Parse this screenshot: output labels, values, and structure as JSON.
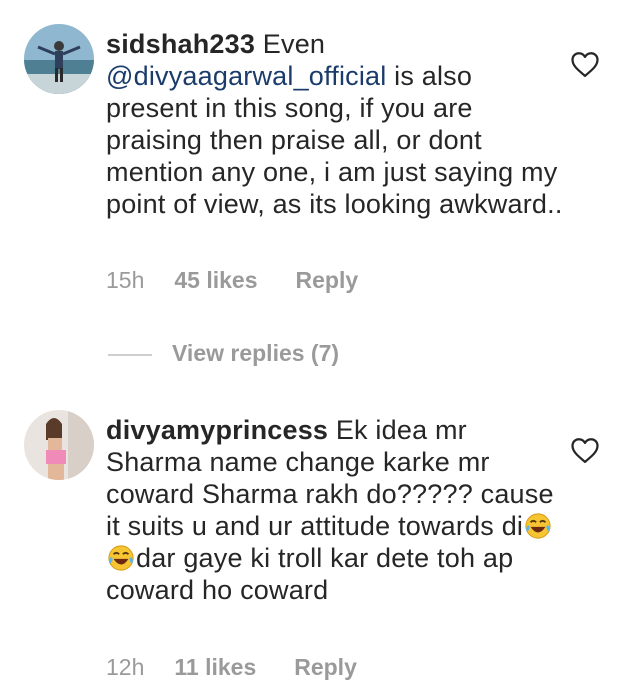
{
  "comments": [
    {
      "username": "sidshah233",
      "text_before": " Even ",
      "mention": "@divyaagarwal_official",
      "text_after": " is also present in this song, if you are praising then praise all, or dont mention any one, i am just saying my point of view, as its looking awkward..",
      "time": "15h",
      "likes": "45 likes",
      "reply": "Reply",
      "view_replies": "View replies (7)",
      "avatar_icon": "avatar-photo-person-beach"
    },
    {
      "username": "divyamyprincess",
      "text_part1": " Ek idea mr Sharma name change karke mr coward Sharma rakh do????? cause it suits u and ur attitude towards di",
      "emoji_1": "😂",
      "emoji_2": "😂",
      "text_part2": "dar gaye ki troll kar dete toh ap coward ho coward",
      "time": "12h",
      "likes": "11 likes",
      "reply": "Reply",
      "avatar_icon": "avatar-photo-person-pink"
    }
  ],
  "colors": {
    "text": "#262626",
    "mention": "#1b3c6b",
    "meta": "#9a9a9a"
  }
}
